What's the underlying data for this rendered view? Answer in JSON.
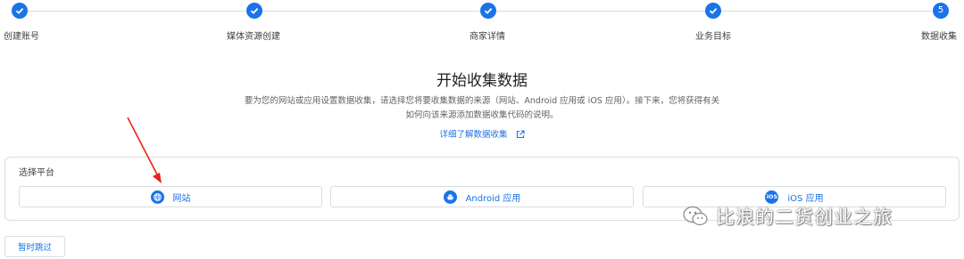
{
  "stepper": {
    "steps": [
      {
        "label": "创建账号",
        "status": "done"
      },
      {
        "label": "媒体资源创建",
        "status": "done"
      },
      {
        "label": "商家详情",
        "status": "done"
      },
      {
        "label": "业务目标",
        "status": "done"
      },
      {
        "label": "数据收集",
        "status": "current",
        "number": "5"
      }
    ]
  },
  "hero": {
    "title": "开始收集数据",
    "description": "要为您的网站或应用设置数据收集，请选择您将要收集数据的来源（网站、Android 应用或 iOS 应用）。接下来，您将获得有关如何向该来源添加数据收集代码的说明。",
    "learn_more": "详细了解数据收集"
  },
  "platform": {
    "title": "选择平台",
    "options": [
      {
        "label": "网站",
        "icon": "globe-icon"
      },
      {
        "label": "Android 应用",
        "icon": "android-icon"
      },
      {
        "label": "iOS 应用",
        "icon": "ios-icon",
        "icon_text": "iOS"
      }
    ]
  },
  "skip": {
    "label": "暂时跳过"
  },
  "watermark": {
    "text": "比浪的二货创业之旅"
  },
  "colors": {
    "accent": "#1a73e8",
    "annotation_arrow": "#e8231a"
  }
}
